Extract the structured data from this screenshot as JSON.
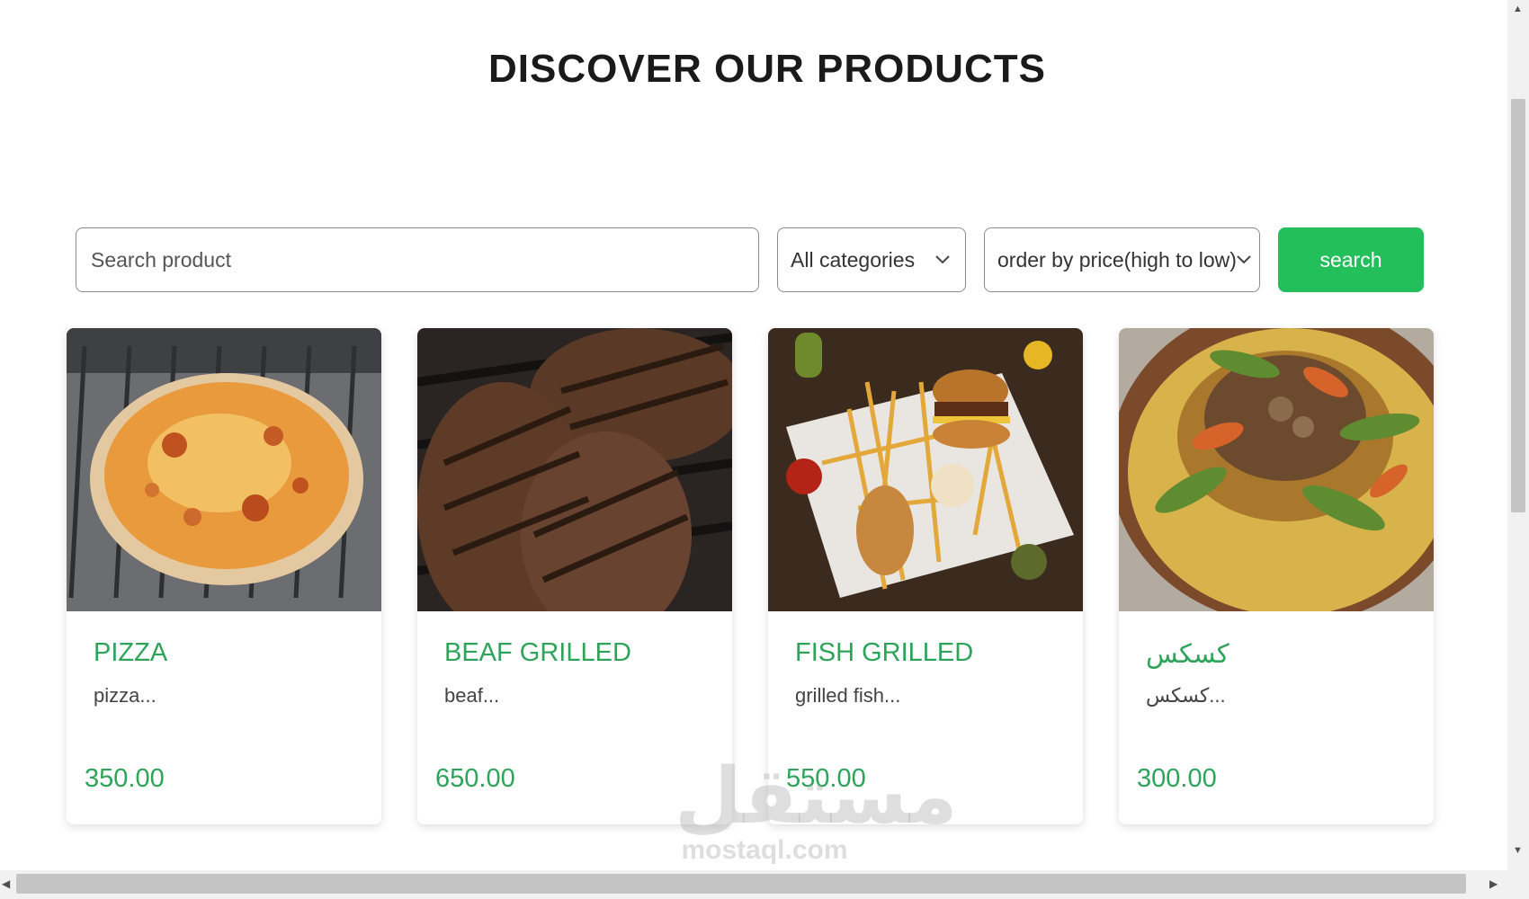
{
  "page": {
    "title": "DISCOVER OUR PRODUCTS"
  },
  "filters": {
    "search_placeholder": "Search product",
    "category_selected": "All categories",
    "order_selected": "order by price(high to low)",
    "search_button": "search"
  },
  "products": [
    {
      "title": "PIZZA",
      "desc": "pizza...",
      "price": "350.00",
      "image": "pizza-photo"
    },
    {
      "title": "BEAF GRILLED",
      "desc": "beaf...",
      "price": "650.00",
      "image": "grilled-beef-photo"
    },
    {
      "title": "FISH GRILLED",
      "desc": "grilled fish...",
      "price": "550.00",
      "image": "burger-fries-photo"
    },
    {
      "title": "كسكس",
      "desc": "كسكس...",
      "price": "300.00",
      "image": "couscous-photo"
    }
  ],
  "watermark": {
    "logo": "مستقل",
    "text": "mostaql.com"
  },
  "colors": {
    "accent": "#22bf5b",
    "title_green": "#2ea45a"
  }
}
